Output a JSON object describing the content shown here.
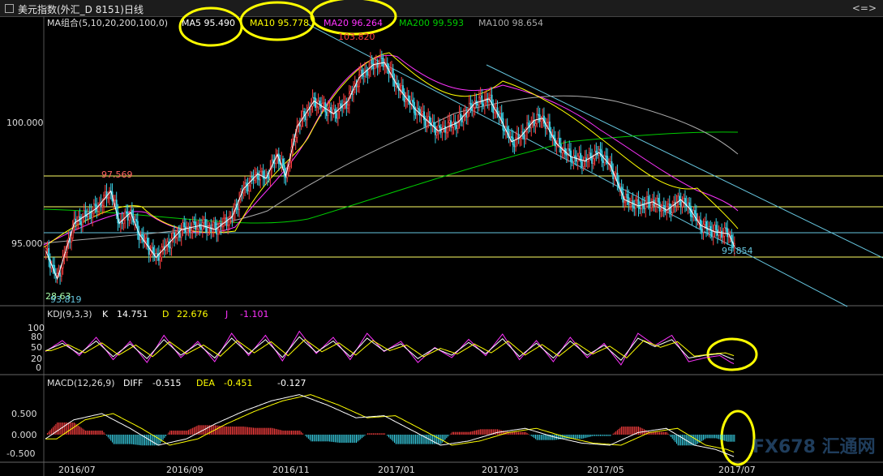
{
  "title": "美元指数(外汇_D 8151)日线",
  "title_ctrl": "<=>",
  "colors": {
    "bg": "#000000",
    "up": "#ff4040",
    "down": "#39d1e6",
    "ma5": "#ffffff",
    "ma10": "#ffff00",
    "ma20": "#ff33ff",
    "ma200": "#00cc00",
    "ma100": "#aaaaaa",
    "channel": "#66c6df",
    "hline": "#ffff66",
    "annot": "#ffff00"
  },
  "legend_main": {
    "label": "MA组合(5,10,20,200,100,0)",
    "ma5": "MA5 95.490",
    "ma10": "MA10 95.778",
    "ma20": "MA20 96.264",
    "ma200": "MA200 99.593",
    "ma100": "MA100 98.654"
  },
  "legend_kdj": {
    "label": "KDJ(9,3,3)",
    "k": "K",
    "k_val": "14.751",
    "d": "D",
    "d_val": "22.676",
    "j": "J",
    "j_val": "-1.101"
  },
  "legend_macd": {
    "label": "MACD(12,26,9)",
    "diff": "DIFF",
    "diff_val": "-0.515",
    "dea": "DEA",
    "dea_val": "-0.451",
    "macd_val": "-0.127"
  },
  "annotations": {
    "high": "103.820",
    "level": "97.569",
    "last": "95.854",
    "low": "93.819",
    "low_prefix": "28.63"
  },
  "chart_data": {
    "type": "candlestick",
    "title": "美元指数(外汇_D 8151)日线",
    "y_ticks_main": [
      "100.000",
      "95.000"
    ],
    "y_ticks_kdj": [
      "100",
      "80",
      "50",
      "20",
      "0"
    ],
    "y_ticks_macd": [
      "0.500",
      "0.000",
      "-0.500"
    ],
    "x_ticks": [
      "2016/07",
      "2016/09",
      "2016/11",
      "2017/01",
      "2017/03",
      "2017/05",
      "2017/07"
    ],
    "ylim_main": [
      92.5,
      104.5
    ],
    "close_path": [
      [
        0,
        94.6
      ],
      [
        8,
        93.3
      ],
      [
        20,
        95.9
      ],
      [
        36,
        96.6
      ],
      [
        46,
        97.4
      ],
      [
        52,
        95.9
      ],
      [
        60,
        96.4
      ],
      [
        66,
        95.4
      ],
      [
        78,
        94.3
      ],
      [
        96,
        95.6
      ],
      [
        110,
        95.8
      ],
      [
        120,
        95.6
      ],
      [
        132,
        96.2
      ],
      [
        140,
        97.5
      ],
      [
        150,
        98.2
      ],
      [
        156,
        98.0
      ],
      [
        164,
        99.1
      ],
      [
        170,
        98.1
      ],
      [
        178,
        100.4
      ],
      [
        190,
        101.6
      ],
      [
        204,
        101.0
      ],
      [
        214,
        101.6
      ],
      [
        222,
        102.7
      ],
      [
        232,
        103.3
      ],
      [
        240,
        103.4
      ],
      [
        250,
        102.2
      ],
      [
        262,
        101.2
      ],
      [
        278,
        100.2
      ],
      [
        292,
        100.6
      ],
      [
        304,
        101.5
      ],
      [
        314,
        101.7
      ],
      [
        322,
        100.8
      ],
      [
        330,
        99.7
      ],
      [
        336,
        99.9
      ],
      [
        346,
        100.7
      ],
      [
        352,
        100.8
      ],
      [
        362,
        99.6
      ],
      [
        372,
        99.0
      ],
      [
        382,
        98.8
      ],
      [
        392,
        99.2
      ],
      [
        400,
        98.6
      ],
      [
        410,
        97.0
      ],
      [
        420,
        96.7
      ],
      [
        430,
        96.9
      ],
      [
        440,
        96.5
      ],
      [
        450,
        97.0
      ],
      [
        456,
        96.6
      ],
      [
        464,
        95.8
      ],
      [
        474,
        95.5
      ],
      [
        484,
        95.4
      ],
      [
        488,
        94.8
      ]
    ],
    "kdj_path": [
      [
        0,
        45
      ],
      [
        12,
        72
      ],
      [
        24,
        35
      ],
      [
        36,
        80
      ],
      [
        48,
        25
      ],
      [
        60,
        70
      ],
      [
        72,
        18
      ],
      [
        84,
        85
      ],
      [
        96,
        30
      ],
      [
        108,
        70
      ],
      [
        120,
        20
      ],
      [
        132,
        90
      ],
      [
        144,
        35
      ],
      [
        156,
        85
      ],
      [
        168,
        22
      ],
      [
        180,
        95
      ],
      [
        192,
        40
      ],
      [
        204,
        80
      ],
      [
        216,
        25
      ],
      [
        228,
        90
      ],
      [
        240,
        45
      ],
      [
        252,
        70
      ],
      [
        264,
        18
      ],
      [
        276,
        55
      ],
      [
        288,
        30
      ],
      [
        300,
        75
      ],
      [
        312,
        35
      ],
      [
        324,
        88
      ],
      [
        336,
        25
      ],
      [
        348,
        72
      ],
      [
        360,
        20
      ],
      [
        372,
        80
      ],
      [
        384,
        30
      ],
      [
        396,
        65
      ],
      [
        408,
        12
      ],
      [
        420,
        90
      ],
      [
        432,
        60
      ],
      [
        444,
        85
      ],
      [
        456,
        20
      ],
      [
        468,
        30
      ],
      [
        478,
        35
      ],
      [
        486,
        18
      ],
      [
        488,
        15
      ]
    ],
    "macd_path": [
      [
        0,
        -0.1
      ],
      [
        20,
        0.35
      ],
      [
        40,
        0.5
      ],
      [
        60,
        0.15
      ],
      [
        80,
        -0.25
      ],
      [
        100,
        -0.1
      ],
      [
        120,
        0.25
      ],
      [
        140,
        0.55
      ],
      [
        160,
        0.8
      ],
      [
        180,
        0.95
      ],
      [
        200,
        0.7
      ],
      [
        220,
        0.4
      ],
      [
        240,
        0.45
      ],
      [
        260,
        0.1
      ],
      [
        280,
        -0.25
      ],
      [
        300,
        -0.15
      ],
      [
        320,
        0.05
      ],
      [
        340,
        0.15
      ],
      [
        360,
        -0.05
      ],
      [
        380,
        -0.2
      ],
      [
        400,
        -0.25
      ],
      [
        420,
        0.05
      ],
      [
        440,
        0.15
      ],
      [
        460,
        -0.25
      ],
      [
        475,
        -0.35
      ],
      [
        488,
        -0.52
      ]
    ]
  },
  "watermark": "FX678 汇通网"
}
